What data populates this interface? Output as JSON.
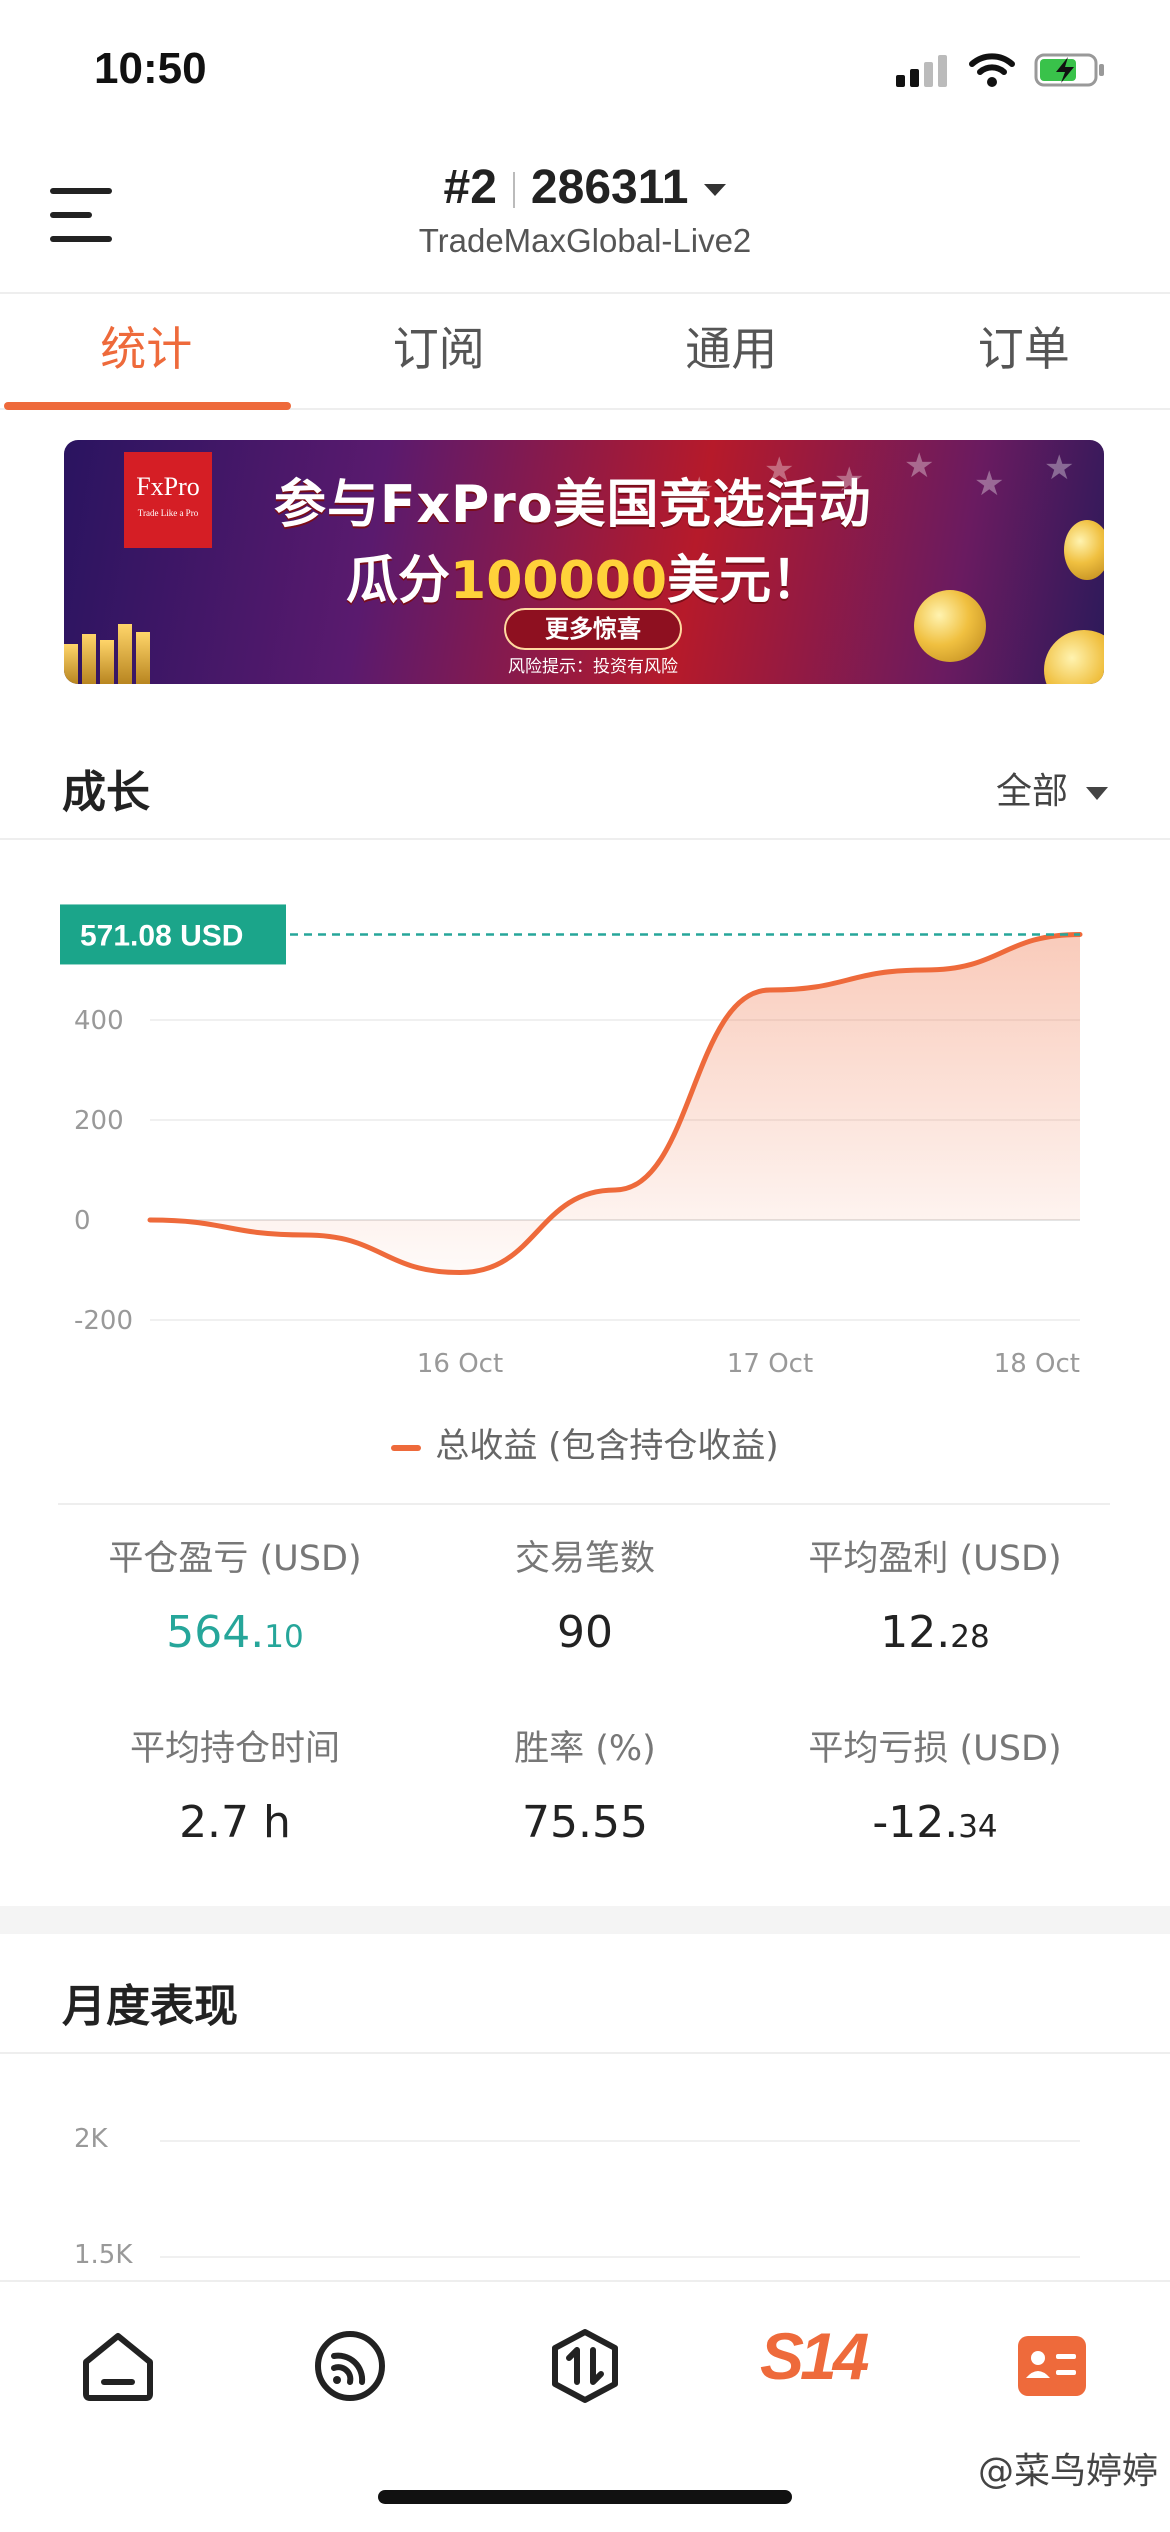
{
  "status_bar": {
    "time": "10:50"
  },
  "header": {
    "account_prefix": "#2",
    "account_number": "286311",
    "server": "TradeMaxGlobal-Live2",
    "menu_icon": "hamburger-icon"
  },
  "tabs": [
    {
      "label": "统计",
      "active": true
    },
    {
      "label": "订阅",
      "active": false
    },
    {
      "label": "通用",
      "active": false
    },
    {
      "label": "订单",
      "active": false
    }
  ],
  "banner": {
    "logo": "FxPro",
    "logo_tagline": "Trade Like a Pro",
    "line1": "参与FxPro美国竞选活动",
    "line2_prefix": "瓜分",
    "line2_amount": "100000",
    "line2_suffix": "美元！",
    "cta": "更多惊喜",
    "risk": "风险提示：投资有风险"
  },
  "growth": {
    "title": "成长",
    "filter": "全部",
    "current_value_label": "571.08 USD",
    "legend": "总收益 (包含持仓收益)"
  },
  "chart_data": {
    "type": "area",
    "x": [
      "15 Oct",
      "15.5 Oct",
      "16 Oct",
      "16.5 Oct",
      "17 Oct",
      "17.5 Oct",
      "18 Oct"
    ],
    "x_tick_labels": [
      "16 Oct",
      "17 Oct",
      "18 Oct"
    ],
    "series": [
      {
        "values": [
          0,
          -30,
          -105,
          60,
          460,
          500,
          571.08
        ]
      }
    ],
    "y_tick_labels": [
      "400",
      "200",
      "0",
      "-200"
    ],
    "ylim": [
      -200,
      600
    ],
    "legend": [
      "总收益 (包含持仓收益)"
    ],
    "reference_label": "571.08 USD",
    "grid": true,
    "line_color": "#ee6a3b",
    "reference_color": "#26a69a"
  },
  "stats": [
    {
      "label": "平仓盈亏 (USD)",
      "value_main": "564.",
      "value_small": "10",
      "color": "green"
    },
    {
      "label": "交易笔数",
      "value_main": "90",
      "value_small": ""
    },
    {
      "label": "平均盈利 (USD)",
      "value_main": "12.",
      "value_small": "28"
    },
    {
      "label": "平均持仓时间",
      "value_main": "2.7 h",
      "value_small": ""
    },
    {
      "label": "胜率 (%)",
      "value_main": "75.55",
      "value_small": ""
    },
    {
      "label": "平均亏损 (USD)",
      "value_main": "-12.",
      "value_small": "34"
    }
  ],
  "monthly": {
    "title": "月度表现",
    "y_ticks": [
      "2K",
      "1.5K"
    ]
  },
  "bottom_nav": [
    {
      "icon": "home-icon"
    },
    {
      "icon": "signal-icon"
    },
    {
      "icon": "trade-icon"
    },
    {
      "icon": "s14-logo-icon",
      "label": "S14"
    },
    {
      "icon": "profile-card-icon"
    }
  ],
  "watermark": "@菜鸟婷婷",
  "colors": {
    "accent": "#ee6a3b",
    "profit": "#26a69a"
  }
}
